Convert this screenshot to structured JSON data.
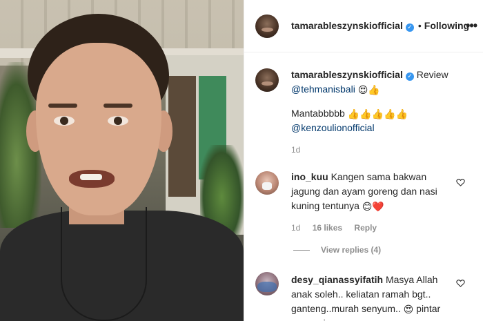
{
  "post": {
    "owner": "tamarableszynskiofficial",
    "follow_separator": "•",
    "follow_status": "Following",
    "more_glyph": "•••"
  },
  "caption": {
    "username": "tamarableszynskiofficial",
    "word": "Review",
    "mention1": "@tehmanisbali",
    "emoji1": "😍👍",
    "line2": "Mantabbbbb",
    "emoji2": "👍👍👍👍👍",
    "mention2": "@kenzoulionofficial",
    "time": "1d"
  },
  "comments": [
    {
      "username": "ino_kuu",
      "text": "Kangen sama bakwan jagung dan ayam goreng dan nasi kuning tentunya",
      "emoji": "😊❤️",
      "time": "1d",
      "likes": "16 likes",
      "reply": "Reply",
      "view_replies": "View replies (4)"
    },
    {
      "username": "desy_qianassyifatih",
      "text": "Masya Allah anak soleh.. keliatan ramah bgt.. ganteng..murah senyum..",
      "emoji": "😍",
      "text2": "pintar promosi nya"
    }
  ],
  "icons": {
    "verified": "verified-badge-icon",
    "heart": "heart-outline-icon"
  },
  "colors": {
    "verified": "#3897f0",
    "link": "#00376b",
    "meta": "#8e8e8e"
  }
}
